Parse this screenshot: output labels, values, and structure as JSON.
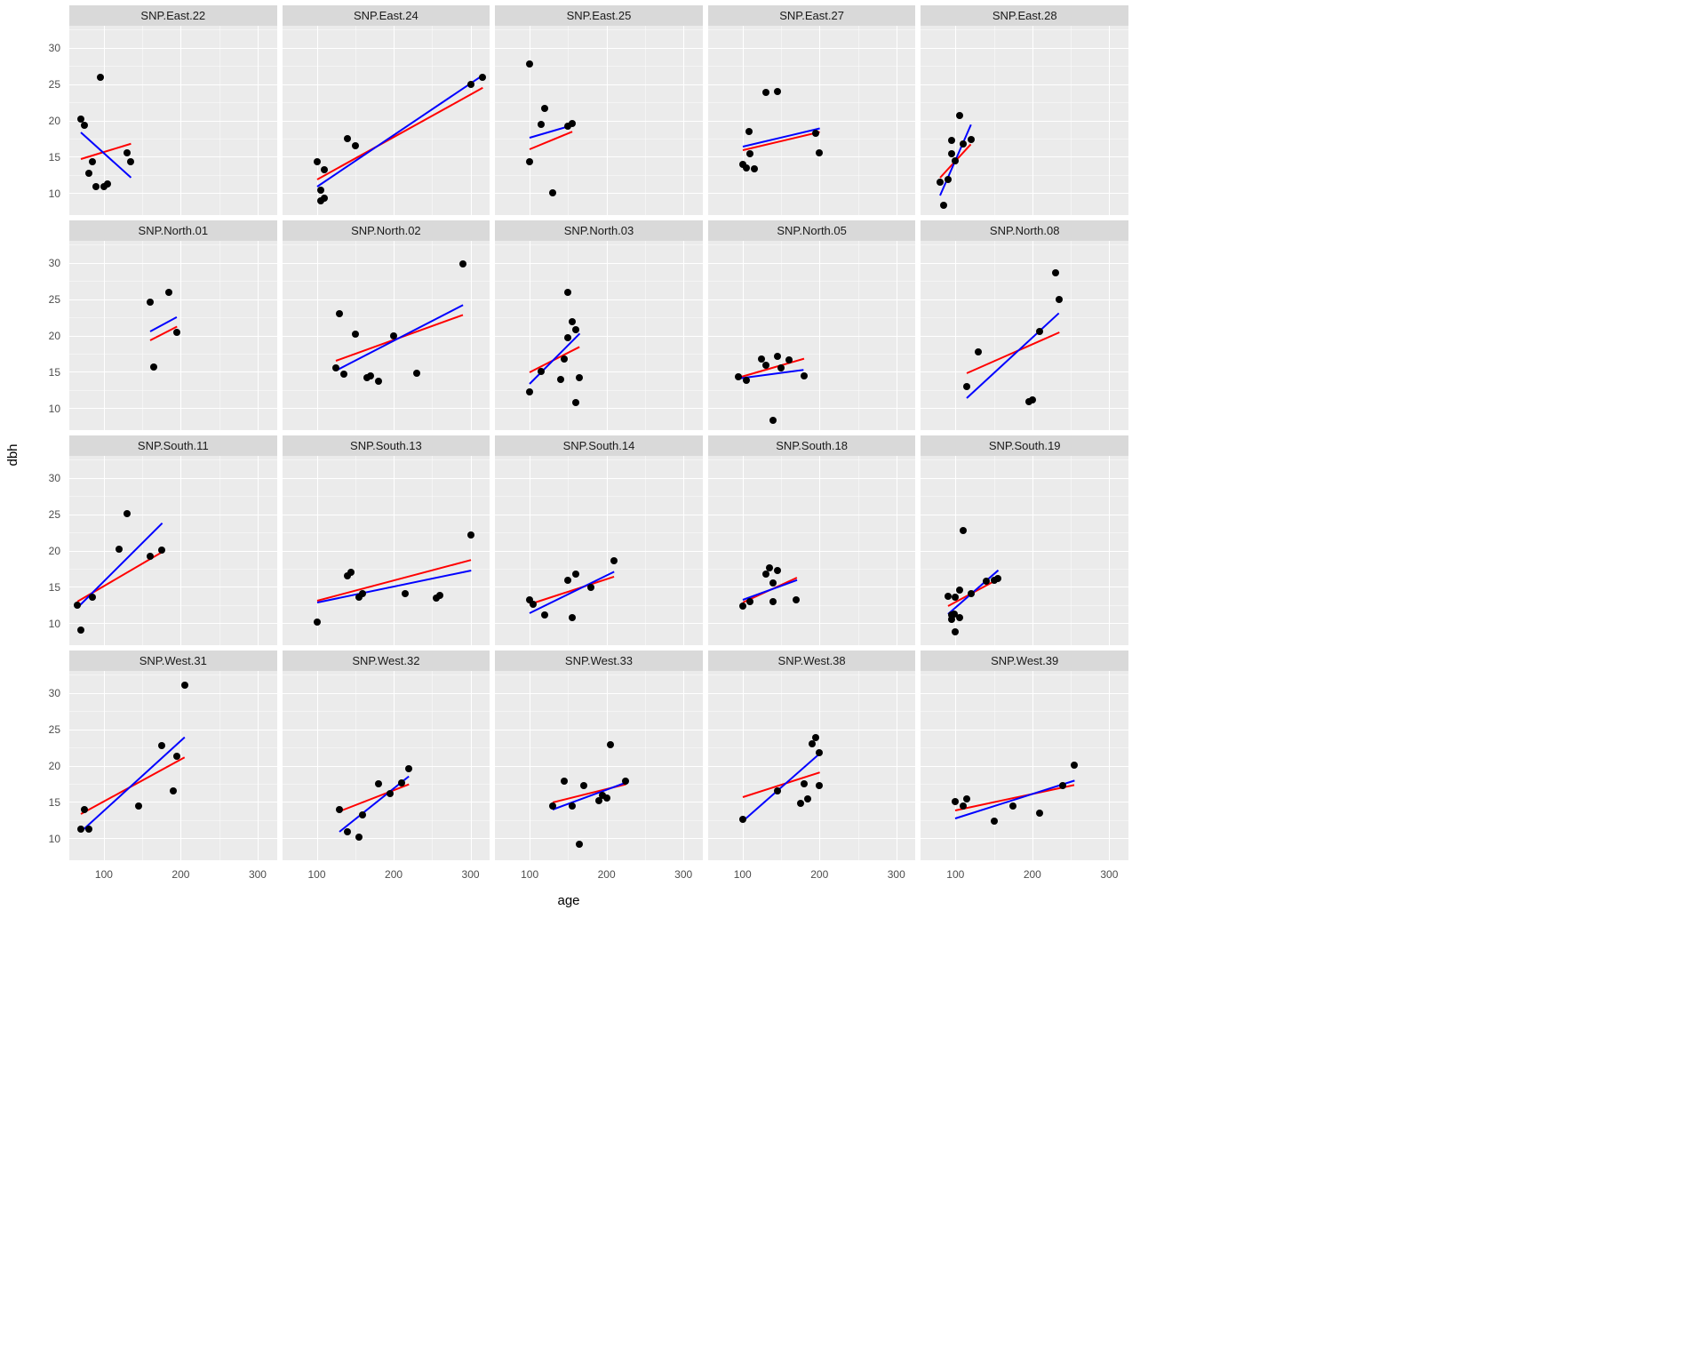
{
  "xlabel": "age",
  "ylabel": "dbh",
  "xlim": [
    55,
    325
  ],
  "ylim": [
    7,
    33
  ],
  "xticks": [
    100,
    200,
    300
  ],
  "yticks": [
    10,
    15,
    20,
    25,
    30
  ],
  "colors": {
    "fit_blue": "#0000ff",
    "fit_red": "#ff0000",
    "point": "#000000"
  },
  "chart_data": [
    {
      "facet": "SNP.East.22",
      "points": [
        {
          "x": 70,
          "y": 20.2
        },
        {
          "x": 75,
          "y": 19.3
        },
        {
          "x": 80,
          "y": 12.7
        },
        {
          "x": 85,
          "y": 14.3
        },
        {
          "x": 90,
          "y": 10.9
        },
        {
          "x": 95,
          "y": 25.9
        },
        {
          "x": 100,
          "y": 10.9
        },
        {
          "x": 105,
          "y": 11.3
        },
        {
          "x": 130,
          "y": 15.6
        },
        {
          "x": 135,
          "y": 14.3
        }
      ],
      "blue": {
        "x1": 70,
        "y1": 18.5,
        "x2": 135,
        "y2": 12.3
      },
      "red": {
        "x1": 70,
        "y1": 14.8,
        "x2": 135,
        "y2": 16.9
      }
    },
    {
      "facet": "SNP.East.24",
      "points": [
        {
          "x": 100,
          "y": 14.3
        },
        {
          "x": 105,
          "y": 10.4
        },
        {
          "x": 105,
          "y": 8.9
        },
        {
          "x": 110,
          "y": 9.3
        },
        {
          "x": 110,
          "y": 13.2
        },
        {
          "x": 140,
          "y": 17.5
        },
        {
          "x": 150,
          "y": 16.5
        },
        {
          "x": 300,
          "y": 25.0
        },
        {
          "x": 315,
          "y": 25.9
        }
      ],
      "blue": {
        "x1": 100,
        "y1": 11.0,
        "x2": 315,
        "y2": 26.3
      },
      "red": {
        "x1": 100,
        "y1": 12.0,
        "x2": 315,
        "y2": 24.6
      }
    },
    {
      "facet": "SNP.East.25",
      "points": [
        {
          "x": 100,
          "y": 27.8
        },
        {
          "x": 100,
          "y": 14.3
        },
        {
          "x": 115,
          "y": 19.5
        },
        {
          "x": 120,
          "y": 21.6
        },
        {
          "x": 130,
          "y": 10.1
        },
        {
          "x": 150,
          "y": 19.2
        },
        {
          "x": 155,
          "y": 19.6
        }
      ],
      "blue": {
        "x1": 100,
        "y1": 17.8,
        "x2": 155,
        "y2": 19.5
      },
      "red": {
        "x1": 100,
        "y1": 16.2,
        "x2": 155,
        "y2": 18.6
      }
    },
    {
      "facet": "SNP.East.27",
      "points": [
        {
          "x": 100,
          "y": 14.0
        },
        {
          "x": 105,
          "y": 13.5
        },
        {
          "x": 108,
          "y": 18.5
        },
        {
          "x": 110,
          "y": 15.4
        },
        {
          "x": 115,
          "y": 13.4
        },
        {
          "x": 130,
          "y": 23.9
        },
        {
          "x": 145,
          "y": 24.0
        },
        {
          "x": 195,
          "y": 18.2
        },
        {
          "x": 200,
          "y": 15.5
        }
      ],
      "blue": {
        "x1": 100,
        "y1": 16.5,
        "x2": 200,
        "y2": 19.0
      },
      "red": {
        "x1": 100,
        "y1": 16.0,
        "x2": 200,
        "y2": 18.5
      }
    },
    {
      "facet": "SNP.East.28",
      "points": [
        {
          "x": 80,
          "y": 11.5
        },
        {
          "x": 85,
          "y": 8.4
        },
        {
          "x": 90,
          "y": 11.9
        },
        {
          "x": 95,
          "y": 15.4
        },
        {
          "x": 95,
          "y": 17.2
        },
        {
          "x": 100,
          "y": 14.5
        },
        {
          "x": 105,
          "y": 20.7
        },
        {
          "x": 110,
          "y": 16.8
        },
        {
          "x": 120,
          "y": 17.4
        }
      ],
      "blue": {
        "x1": 80,
        "y1": 9.8,
        "x2": 120,
        "y2": 19.5
      },
      "red": {
        "x1": 80,
        "y1": 12.2,
        "x2": 120,
        "y2": 16.8
      }
    },
    {
      "facet": "SNP.North.01",
      "points": [
        {
          "x": 160,
          "y": 24.6
        },
        {
          "x": 165,
          "y": 15.7
        },
        {
          "x": 185,
          "y": 25.9
        },
        {
          "x": 195,
          "y": 20.4
        }
      ],
      "blue": {
        "x1": 160,
        "y1": 20.7,
        "x2": 195,
        "y2": 22.7
      },
      "red": {
        "x1": 160,
        "y1": 19.5,
        "x2": 195,
        "y2": 21.4
      }
    },
    {
      "facet": "SNP.North.02",
      "points": [
        {
          "x": 125,
          "y": 15.6
        },
        {
          "x": 130,
          "y": 23.0
        },
        {
          "x": 135,
          "y": 14.7
        },
        {
          "x": 150,
          "y": 20.2
        },
        {
          "x": 165,
          "y": 14.2
        },
        {
          "x": 170,
          "y": 14.5
        },
        {
          "x": 180,
          "y": 13.7
        },
        {
          "x": 200,
          "y": 20.0
        },
        {
          "x": 230,
          "y": 14.8
        },
        {
          "x": 290,
          "y": 29.8
        }
      ],
      "blue": {
        "x1": 125,
        "y1": 15.3,
        "x2": 290,
        "y2": 24.3
      },
      "red": {
        "x1": 125,
        "y1": 16.6,
        "x2": 290,
        "y2": 22.9
      }
    },
    {
      "facet": "SNP.North.03",
      "points": [
        {
          "x": 100,
          "y": 12.3
        },
        {
          "x": 115,
          "y": 15.0
        },
        {
          "x": 140,
          "y": 13.9
        },
        {
          "x": 145,
          "y": 16.8
        },
        {
          "x": 150,
          "y": 19.7
        },
        {
          "x": 150,
          "y": 25.9
        },
        {
          "x": 155,
          "y": 21.9
        },
        {
          "x": 160,
          "y": 10.8
        },
        {
          "x": 160,
          "y": 20.8
        },
        {
          "x": 165,
          "y": 14.2
        }
      ],
      "blue": {
        "x1": 100,
        "y1": 13.5,
        "x2": 165,
        "y2": 20.4
      },
      "red": {
        "x1": 100,
        "y1": 15.0,
        "x2": 165,
        "y2": 18.5
      }
    },
    {
      "facet": "SNP.North.05",
      "points": [
        {
          "x": 95,
          "y": 14.3
        },
        {
          "x": 105,
          "y": 13.8
        },
        {
          "x": 125,
          "y": 16.8
        },
        {
          "x": 130,
          "y": 15.9
        },
        {
          "x": 140,
          "y": 8.4
        },
        {
          "x": 145,
          "y": 17.1
        },
        {
          "x": 150,
          "y": 15.6
        },
        {
          "x": 160,
          "y": 16.7
        },
        {
          "x": 180,
          "y": 14.4
        }
      ],
      "blue": {
        "x1": 95,
        "y1": 14.2,
        "x2": 180,
        "y2": 15.4
      },
      "red": {
        "x1": 95,
        "y1": 14.3,
        "x2": 180,
        "y2": 16.9
      }
    },
    {
      "facet": "SNP.North.08",
      "points": [
        {
          "x": 115,
          "y": 13.0
        },
        {
          "x": 130,
          "y": 17.7
        },
        {
          "x": 195,
          "y": 10.9
        },
        {
          "x": 200,
          "y": 11.1
        },
        {
          "x": 210,
          "y": 20.6
        },
        {
          "x": 230,
          "y": 28.6
        },
        {
          "x": 235,
          "y": 25.0
        }
      ],
      "blue": {
        "x1": 115,
        "y1": 11.5,
        "x2": 235,
        "y2": 23.2
      },
      "red": {
        "x1": 115,
        "y1": 14.9,
        "x2": 235,
        "y2": 20.5
      }
    },
    {
      "facet": "SNP.South.11",
      "points": [
        {
          "x": 65,
          "y": 12.5
        },
        {
          "x": 70,
          "y": 9.1
        },
        {
          "x": 85,
          "y": 13.6
        },
        {
          "x": 120,
          "y": 20.2
        },
        {
          "x": 130,
          "y": 25.1
        },
        {
          "x": 160,
          "y": 19.2
        },
        {
          "x": 175,
          "y": 20.1
        }
      ],
      "blue": {
        "x1": 65,
        "y1": 12.2,
        "x2": 175,
        "y2": 23.8
      },
      "red": {
        "x1": 65,
        "y1": 13.1,
        "x2": 175,
        "y2": 19.9
      }
    },
    {
      "facet": "SNP.South.13",
      "points": [
        {
          "x": 100,
          "y": 10.2
        },
        {
          "x": 140,
          "y": 16.5
        },
        {
          "x": 145,
          "y": 17.0
        },
        {
          "x": 155,
          "y": 13.6
        },
        {
          "x": 160,
          "y": 14.1
        },
        {
          "x": 215,
          "y": 14.1
        },
        {
          "x": 255,
          "y": 13.5
        },
        {
          "x": 260,
          "y": 13.8
        },
        {
          "x": 300,
          "y": 22.1
        }
      ],
      "blue": {
        "x1": 100,
        "y1": 13.0,
        "x2": 300,
        "y2": 17.4
      },
      "red": {
        "x1": 100,
        "y1": 13.2,
        "x2": 300,
        "y2": 18.8
      }
    },
    {
      "facet": "SNP.South.14",
      "points": [
        {
          "x": 100,
          "y": 13.2
        },
        {
          "x": 105,
          "y": 12.6
        },
        {
          "x": 120,
          "y": 11.2
        },
        {
          "x": 150,
          "y": 15.9
        },
        {
          "x": 155,
          "y": 10.8
        },
        {
          "x": 160,
          "y": 16.8
        },
        {
          "x": 180,
          "y": 14.9
        },
        {
          "x": 210,
          "y": 18.6
        }
      ],
      "blue": {
        "x1": 100,
        "y1": 11.5,
        "x2": 210,
        "y2": 17.2
      },
      "red": {
        "x1": 100,
        "y1": 12.7,
        "x2": 210,
        "y2": 16.5
      }
    },
    {
      "facet": "SNP.South.18",
      "points": [
        {
          "x": 100,
          "y": 12.4
        },
        {
          "x": 110,
          "y": 13.0
        },
        {
          "x": 130,
          "y": 16.8
        },
        {
          "x": 135,
          "y": 17.6
        },
        {
          "x": 140,
          "y": 13.0
        },
        {
          "x": 140,
          "y": 15.6
        },
        {
          "x": 145,
          "y": 17.3
        },
        {
          "x": 170,
          "y": 13.2
        }
      ],
      "blue": {
        "x1": 100,
        "y1": 13.3,
        "x2": 170,
        "y2": 16.0
      },
      "red": {
        "x1": 100,
        "y1": 13.0,
        "x2": 170,
        "y2": 16.4
      }
    },
    {
      "facet": "SNP.South.19",
      "points": [
        {
          "x": 90,
          "y": 13.7
        },
        {
          "x": 95,
          "y": 11.1
        },
        {
          "x": 95,
          "y": 10.5
        },
        {
          "x": 98,
          "y": 11.3
        },
        {
          "x": 100,
          "y": 8.8
        },
        {
          "x": 100,
          "y": 13.6
        },
        {
          "x": 105,
          "y": 14.6
        },
        {
          "x": 105,
          "y": 10.8
        },
        {
          "x": 110,
          "y": 22.8
        },
        {
          "x": 120,
          "y": 14.1
        },
        {
          "x": 140,
          "y": 15.8
        },
        {
          "x": 150,
          "y": 15.9
        },
        {
          "x": 155,
          "y": 16.2
        }
      ],
      "blue": {
        "x1": 90,
        "y1": 11.4,
        "x2": 155,
        "y2": 17.4
      },
      "red": {
        "x1": 90,
        "y1": 12.5,
        "x2": 155,
        "y2": 16.2
      }
    },
    {
      "facet": "SNP.West.31",
      "points": [
        {
          "x": 70,
          "y": 11.3
        },
        {
          "x": 75,
          "y": 14.0
        },
        {
          "x": 80,
          "y": 11.3
        },
        {
          "x": 145,
          "y": 14.4
        },
        {
          "x": 175,
          "y": 22.8
        },
        {
          "x": 190,
          "y": 16.5
        },
        {
          "x": 195,
          "y": 21.3
        },
        {
          "x": 205,
          "y": 31.0
        }
      ],
      "blue": {
        "x1": 70,
        "y1": 11.0,
        "x2": 205,
        "y2": 24.0
      },
      "red": {
        "x1": 70,
        "y1": 13.5,
        "x2": 205,
        "y2": 21.3
      }
    },
    {
      "facet": "SNP.West.32",
      "points": [
        {
          "x": 130,
          "y": 14.0
        },
        {
          "x": 140,
          "y": 10.9
        },
        {
          "x": 155,
          "y": 10.2
        },
        {
          "x": 160,
          "y": 13.2
        },
        {
          "x": 180,
          "y": 17.5
        },
        {
          "x": 195,
          "y": 16.1
        },
        {
          "x": 210,
          "y": 17.6
        },
        {
          "x": 220,
          "y": 19.6
        }
      ],
      "blue": {
        "x1": 130,
        "y1": 11.0,
        "x2": 220,
        "y2": 18.6
      },
      "red": {
        "x1": 130,
        "y1": 13.8,
        "x2": 220,
        "y2": 17.5
      }
    },
    {
      "facet": "SNP.West.33",
      "points": [
        {
          "x": 130,
          "y": 14.5
        },
        {
          "x": 145,
          "y": 17.9
        },
        {
          "x": 155,
          "y": 14.5
        },
        {
          "x": 165,
          "y": 9.2
        },
        {
          "x": 170,
          "y": 17.3
        },
        {
          "x": 190,
          "y": 15.2
        },
        {
          "x": 195,
          "y": 15.9
        },
        {
          "x": 200,
          "y": 15.6
        },
        {
          "x": 205,
          "y": 22.9
        },
        {
          "x": 225,
          "y": 17.9
        }
      ],
      "blue": {
        "x1": 130,
        "y1": 14.1,
        "x2": 225,
        "y2": 17.8
      },
      "red": {
        "x1": 130,
        "y1": 15.0,
        "x2": 225,
        "y2": 17.5
      }
    },
    {
      "facet": "SNP.West.38",
      "points": [
        {
          "x": 100,
          "y": 12.6
        },
        {
          "x": 145,
          "y": 16.5
        },
        {
          "x": 175,
          "y": 14.8
        },
        {
          "x": 180,
          "y": 17.5
        },
        {
          "x": 185,
          "y": 15.4
        },
        {
          "x": 190,
          "y": 23.0
        },
        {
          "x": 195,
          "y": 23.8
        },
        {
          "x": 200,
          "y": 21.8
        },
        {
          "x": 200,
          "y": 17.2
        }
      ],
      "blue": {
        "x1": 100,
        "y1": 12.5,
        "x2": 200,
        "y2": 21.8
      },
      "red": {
        "x1": 100,
        "y1": 15.8,
        "x2": 200,
        "y2": 19.2
      }
    },
    {
      "facet": "SNP.West.39",
      "points": [
        {
          "x": 100,
          "y": 15.1
        },
        {
          "x": 110,
          "y": 14.5
        },
        {
          "x": 115,
          "y": 15.4
        },
        {
          "x": 150,
          "y": 12.4
        },
        {
          "x": 175,
          "y": 14.4
        },
        {
          "x": 210,
          "y": 13.5
        },
        {
          "x": 240,
          "y": 17.3
        },
        {
          "x": 255,
          "y": 20.1
        }
      ],
      "blue": {
        "x1": 100,
        "y1": 12.8,
        "x2": 255,
        "y2": 18.0
      },
      "red": {
        "x1": 100,
        "y1": 14.0,
        "x2": 255,
        "y2": 17.5
      }
    }
  ]
}
